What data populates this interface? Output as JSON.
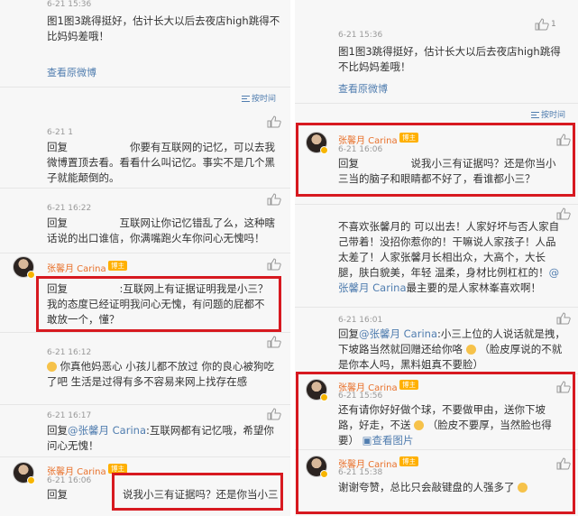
{
  "left": {
    "b1": {
      "time": "6-21 15:36",
      "text": "图1图3跳得挺好，估计长大以后去夜店high跳得不比妈妈差哦！",
      "link": "查看原微博"
    },
    "sort_label": "按时间",
    "c1": {
      "like": "",
      "time": "6-21 1",
      "text": "回复　　　　　　你要有互联网的记忆，可以去我微博置顶去看。看看什么叫记忆。事实不是几个黑子就能颠倒的。"
    },
    "c2": {
      "time": "6-21 16:22",
      "text": "回复　　　　　互联网让你记忆错乱了么，这种瞎话说的出口谁信，你满嘴跑火车你问心无愧吗！"
    },
    "c3": {
      "name": "张馨月 Carina",
      "badge": "博主",
      "text": "回复　　　　　:互联网上有证据证明我是小三？我的态度已经证明我问心无愧，有问题的屁都不敢放一个，懂？"
    },
    "c4": {
      "time": "6-21 16:12",
      "text": "你真他妈恶心 小孩儿都不放过 你的良心被狗吃了吧 生活是过得有多不容易来网上找存在感"
    },
    "c5": {
      "time": "6-21 16:17",
      "prefix": "回复",
      "mention": "@张馨月 Carina",
      "text": ":互联网都有记忆哦，希望你问心无愧！"
    },
    "c6": {
      "name": "张馨月 Carina",
      "badge": "博主",
      "time": "6-21 16:06",
      "prefix": "回复",
      "text": "说我小三有证据吗？还是你当小三"
    }
  },
  "right": {
    "b1": {
      "like": "1",
      "time": "6-21 15:36",
      "text": "图1图3跳得挺好，估计长大以后去夜店high跳得不比妈妈差哦！",
      "link": "查看原微博"
    },
    "sort_label": "按时间",
    "c1": {
      "name": "张馨月 Carina",
      "badge": "博主",
      "time": "6-21 16:06",
      "text": "回复　　　　　说我小三有证据吗？还是你当小三当的脑子和眼睛都不好了，看谁都小三？"
    },
    "c2": {
      "text_a": "不喜欢张馨月的 可以出去！人家好坏与否人家自己带着！没招你惹你的！干嘛说人家孩子！人品太差了！人家张馨月长相出众，大高个，大长腿，肤白貌美，年轻 温柔，身材比例杠杠的！",
      "mention": "@张馨月 Carina",
      "text_b": "最主要的是人家林峯喜欢啊！"
    },
    "c3": {
      "time": "6-21 16:01",
      "prefix": "回复",
      "mention": "@张馨月 Carina",
      "text_a": ":小三上位的人说话就是拽，下坡路当然就回赠还给你咯",
      "text_b": "（脸皮厚说的不就是你本人吗，黑料姐真不要脸）"
    },
    "c4": {
      "name": "张馨月 Carina",
      "badge": "博主",
      "time": "6-21 15:56",
      "text_a": "还有请你好好做个球，不要做甲由，送你下坡路，好走，不送",
      "text_b": "（脸皮不要厚，当然脸也得要）",
      "link": "查看图片"
    },
    "c5": {
      "name": "张馨月 Carina",
      "badge": "博主",
      "time": "6-21 15:38",
      "text": "谢谢夸赞，总比只会敲键盘的人强多了"
    }
  },
  "colors": {
    "link": "#507daf",
    "username": "#e8702a",
    "highlight_box": "#d71920",
    "badge": "#ffb000"
  }
}
